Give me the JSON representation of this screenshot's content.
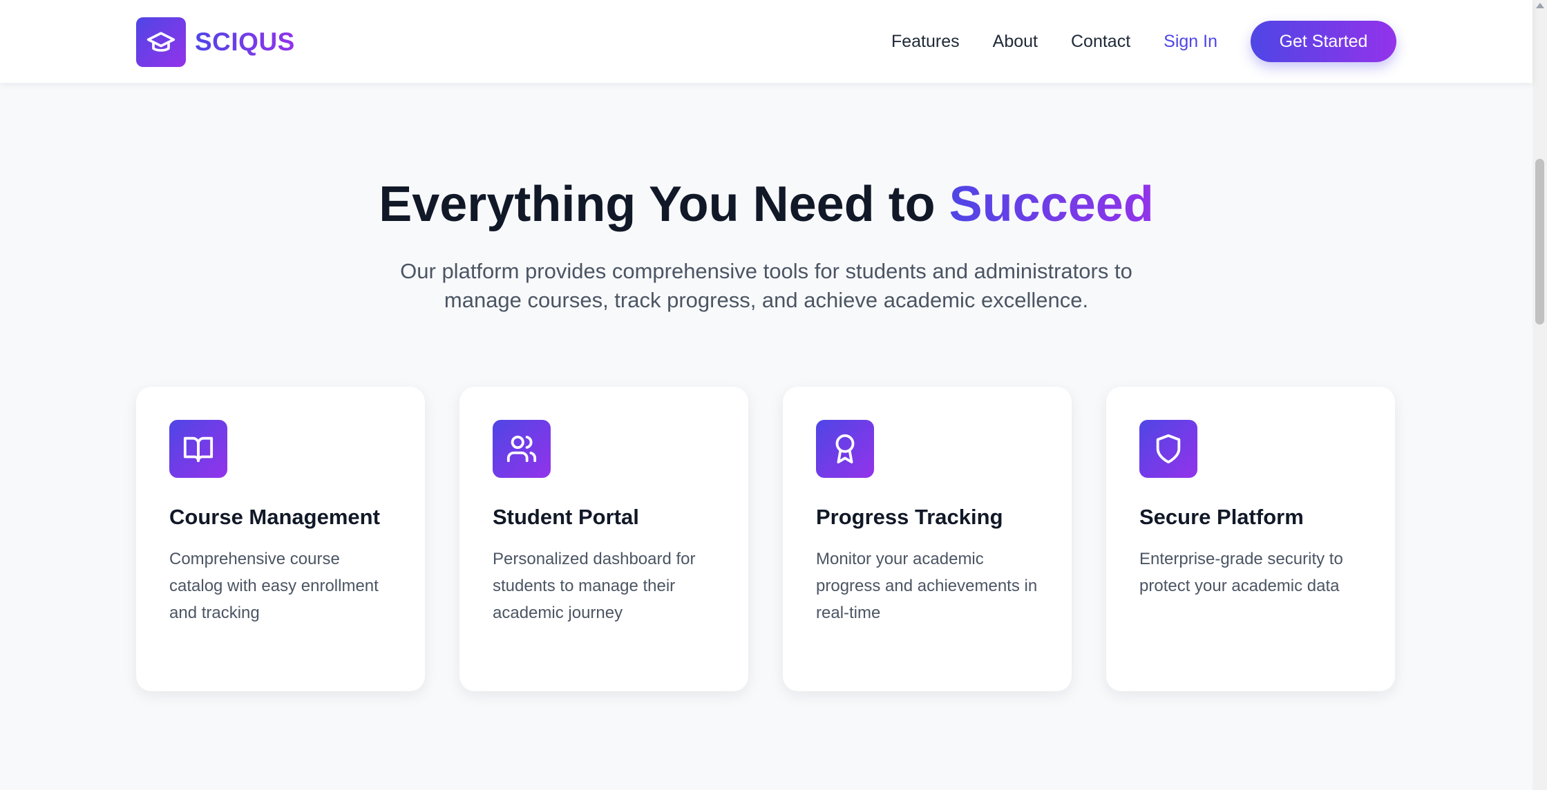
{
  "header": {
    "brand": "SCIQUS",
    "nav": [
      "Features",
      "About",
      "Contact"
    ],
    "signin": "Sign In",
    "cta": "Get Started"
  },
  "hero": {
    "title_main": "Everything You Need to ",
    "title_accent": "Succeed",
    "subtitle": "Our platform provides comprehensive tools for students and administrators to manage courses, track progress, and achieve academic excellence."
  },
  "features": [
    {
      "icon": "book-open-icon",
      "title": "Course Management",
      "desc": "Comprehensive course catalog with easy enrollment and tracking"
    },
    {
      "icon": "users-icon",
      "title": "Student Portal",
      "desc": "Personalized dashboard for students to manage their academic journey"
    },
    {
      "icon": "award-icon",
      "title": "Progress Tracking",
      "desc": "Monitor your academic progress and achievements in real-time"
    },
    {
      "icon": "shield-icon",
      "title": "Secure Platform",
      "desc": "Enterprise-grade security to protect your academic data"
    }
  ],
  "colors": {
    "accent_start": "#4f46e5",
    "accent_end": "#9333ea",
    "heading": "#111827",
    "body_text": "#4b5563",
    "background": "#f8f9fb"
  }
}
